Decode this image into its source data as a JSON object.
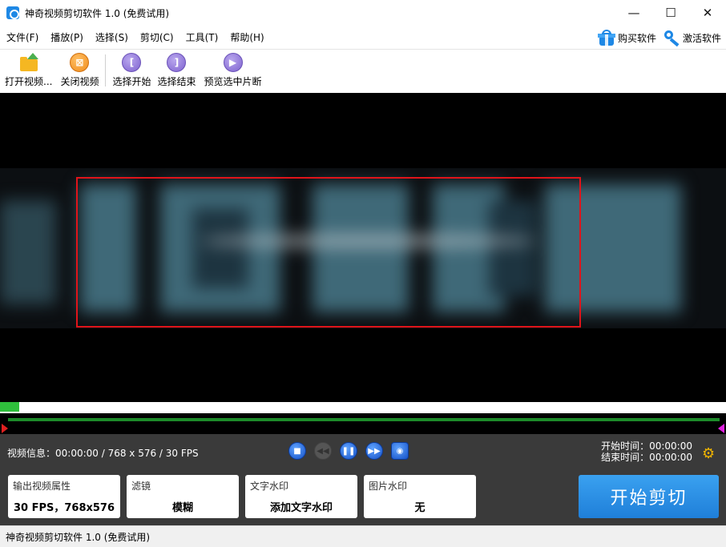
{
  "window": {
    "title": "神奇视频剪切软件 1.0 (免费试用)",
    "controls": {
      "minimize": "—",
      "maximize": "☐",
      "close": "✕"
    }
  },
  "menu": {
    "items": [
      {
        "label": "文件(F)"
      },
      {
        "label": "播放(P)"
      },
      {
        "label": "选择(S)"
      },
      {
        "label": "剪切(C)"
      },
      {
        "label": "工具(T)"
      },
      {
        "label": "帮助(H)"
      }
    ],
    "buy_label": "购买软件",
    "activate_label": "激活软件"
  },
  "toolbar": {
    "open_video": "打开视频...",
    "close_video": "关闭视频",
    "select_start": "选择开始",
    "select_end": "选择结束",
    "preview_selection": "预览选中片断"
  },
  "playback": {
    "progress_fraction": 0.027
  },
  "info": {
    "video_info": "视频信息：00:00:00 / 768 x 576 / 30 FPS",
    "start_time_label": "开始时间：",
    "start_time_value": "00:00:00",
    "end_time_label": "结束时间：",
    "end_time_value": "00:00:00"
  },
  "options": {
    "output_props": {
      "label": "输出视频属性",
      "value": "30 FPS，768x576"
    },
    "filter": {
      "label": "滤镜",
      "value": "模糊"
    },
    "text_watermark": {
      "label": "文字水印",
      "value": "添加文字水印"
    },
    "image_watermark": {
      "label": "图片水印",
      "value": "无"
    }
  },
  "start_button": "开始剪切",
  "statusbar": {
    "text": "神奇视频剪切软件 1.0 (免费试用)"
  },
  "colors": {
    "selection_border": "#e0141a",
    "progress": "#2fbf3c",
    "accent": "#1f7fd9"
  }
}
